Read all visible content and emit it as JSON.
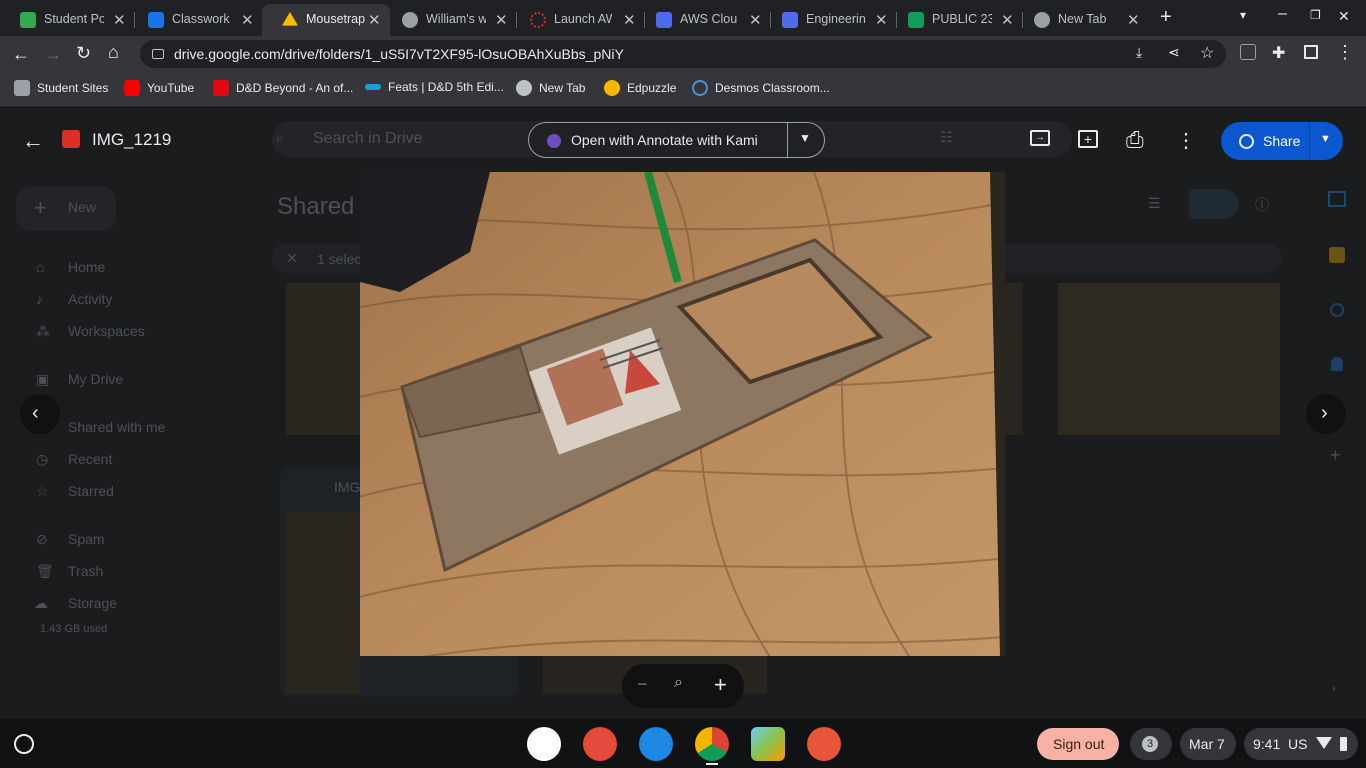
{
  "tabs": [
    {
      "title": "Student Po",
      "color": "#34a853"
    },
    {
      "title": "Classwork",
      "color": "#1a73e8"
    },
    {
      "title": "Mousetrap",
      "color": "#fbbc04"
    },
    {
      "title": "William's w",
      "color": "#9aa0a6"
    },
    {
      "title": "Launch AW",
      "color": "#d93025"
    },
    {
      "title": "AWS Clou",
      "color": "#4f6bed"
    },
    {
      "title": "Engineerin",
      "color": "#4f6bed"
    },
    {
      "title": "PUBLIC 23",
      "color": "#0f9d58"
    },
    {
      "title": "New Tab",
      "color": "#9aa0a6"
    }
  ],
  "address": {
    "url": "drive.google.com/drive/folders/1_uS5I7vT2XF95-lOsuOBAhXuBbs_pNiY"
  },
  "bookmarks": [
    {
      "label": "Student Sites",
      "color": "#9aa0a6"
    },
    {
      "label": "YouTube",
      "color": "#ff0000"
    },
    {
      "label": "D&D Beyond - An of...",
      "color": "#e40712"
    },
    {
      "label": "Feats | D&D 5th Edi...",
      "color": "#1ba0d7"
    },
    {
      "label": "New Tab",
      "color": "#bdc1c6"
    },
    {
      "label": "Edpuzzle",
      "color": "#f5b700"
    },
    {
      "label": "Desmos Classroom...",
      "color": "#4a90d9"
    }
  ],
  "drive": {
    "search_placeholder": "Search in Drive",
    "new_label": "New",
    "nav": [
      "Home",
      "Activity",
      "Workspaces",
      "My Drive",
      "Shared with me",
      "Recent",
      "Starred",
      "Spam",
      "Trash",
      "Storage"
    ],
    "storage_used": "1.43 GB used",
    "heading": "Shared",
    "selected": "1 selec",
    "file_label": "IMG"
  },
  "viewer": {
    "file_name": "IMG_1219",
    "open_with": "Open with Annotate with Kami",
    "share": "Share"
  },
  "shelf": {
    "sign_out": "Sign out",
    "notif_count": "3",
    "date": "Mar 7",
    "time": "9:41",
    "locale": "US"
  },
  "icons": [
    "back-arrow-icon",
    "forward-arrow-icon",
    "reload-icon",
    "home-icon",
    "bookmark-star-icon",
    "extensions-icon",
    "menu-dots-icon",
    "zoom-in-icon",
    "zoom-out-icon",
    "print-icon",
    "add-comment-icon",
    "move-to-icon",
    "chevron-left-icon",
    "chevron-right-icon"
  ]
}
